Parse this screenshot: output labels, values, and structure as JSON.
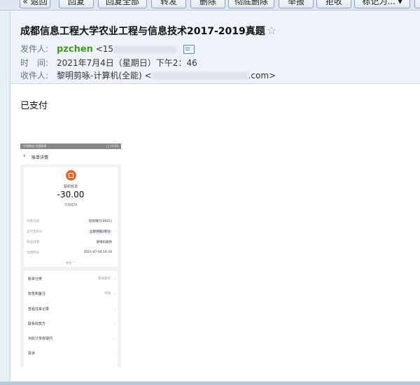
{
  "toolbar": {
    "buttons": [
      {
        "label": "« 返回"
      },
      {
        "label": "回复"
      },
      {
        "label": "回复全部"
      },
      {
        "label": "转发"
      },
      {
        "label": "删除"
      },
      {
        "label": "彻底删除"
      },
      {
        "label": "举报"
      },
      {
        "label": "拒收"
      },
      {
        "label": "标记为... ▾"
      }
    ]
  },
  "mail": {
    "subject": "成都信息工程大学农业工程与信息技术2017-2019真题",
    "star": "☆",
    "sender_label": "发件人:",
    "sender_name": "pzchen",
    "sender_email_prefix": "<15",
    "time_label": "时　间:",
    "time_value": "2021年7月4日（星期日）下午2：46",
    "recipient_label": "收件人:",
    "recipient_name": "黎明剪咏-计算机(全能) <",
    "recipient_email_suffix": ".com>",
    "body_text": "已支付"
  },
  "phone": {
    "status_left": "中国移动 中国联通",
    "status_right": "□ 14:43",
    "back": "‹",
    "title": "账单详情",
    "merchant": "蔡帆数发",
    "amount": "-30.00",
    "status": "交易成功",
    "rows": [
      {
        "k": "付款方式",
        "v": "招商银行(4621)"
      },
      {
        "k": "支付宝积分",
        "v": "立即领取2积分"
      },
      {
        "k": "商品说明",
        "v": "收钱码收款"
      },
      {
        "k": "创建时间",
        "v": "2021-07-04 14:43"
      }
    ],
    "more": "更多 ﹀",
    "items": [
      {
        "k": "账单分类",
        "v": "家居家装"
      },
      {
        "k": "标签和备注",
        "v": "添加"
      },
      {
        "k": "查看往来记录",
        "v": ""
      },
      {
        "k": "联系收款方",
        "v": ""
      },
      {
        "k": "对此订单有疑问",
        "v": ""
      },
      {
        "k": "投诉",
        "v": ""
      }
    ]
  }
}
